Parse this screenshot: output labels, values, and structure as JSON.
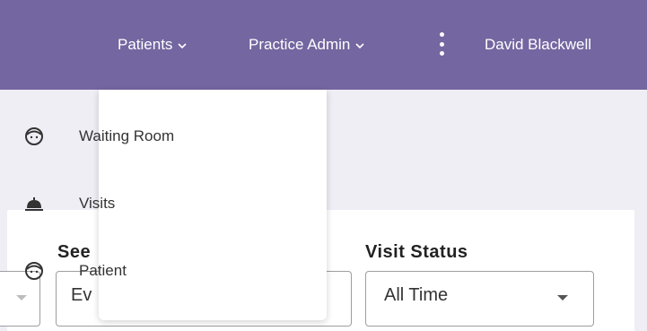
{
  "header": {
    "nav": [
      {
        "label": "Patients",
        "icon": "chevron-down-icon"
      },
      {
        "label": "Practice Admin",
        "icon": "chevron-down-icon"
      }
    ],
    "more_icon": "more-vertical-icon",
    "user_name": "David Blackwell"
  },
  "patients_menu": {
    "items": [
      {
        "label": "Waiting Room",
        "icon": "face-icon"
      },
      {
        "label": "Visits",
        "icon": "bell-icon"
      },
      {
        "label": "Patient",
        "icon": "face-icon"
      }
    ]
  },
  "filters": {
    "see_label": "See",
    "see_value": "Ev",
    "status_label": "Visit Status",
    "status_value": "All Time"
  },
  "colors": {
    "header_bg": "#7466a0",
    "page_bg": "#efeef5"
  }
}
